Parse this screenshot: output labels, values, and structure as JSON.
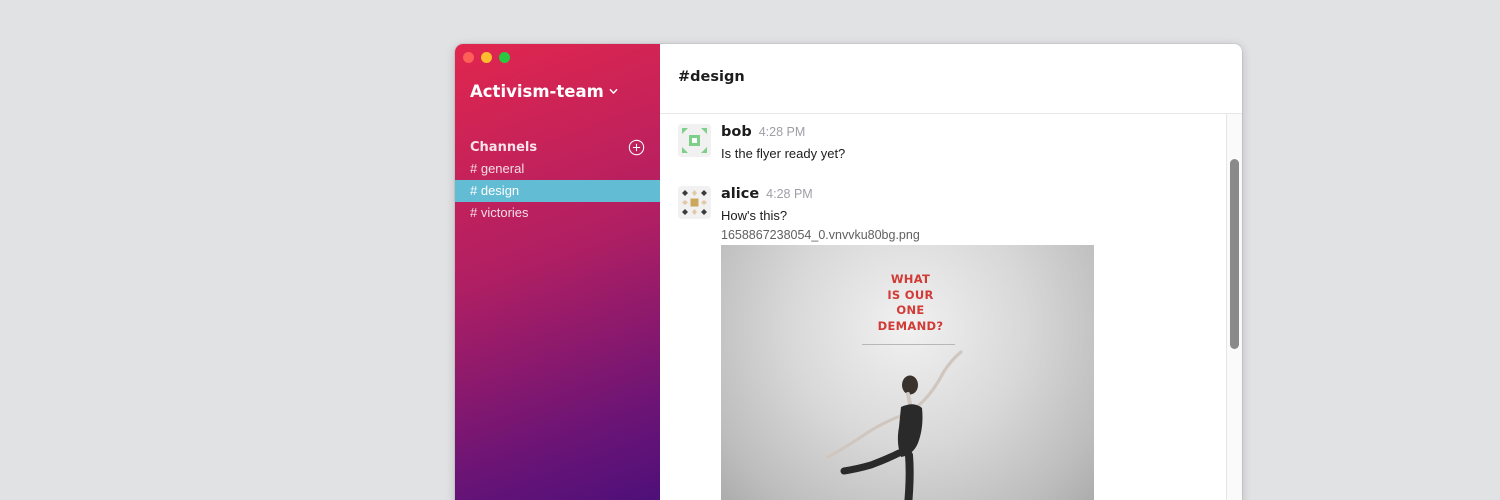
{
  "workspace": {
    "name": "Activism-team"
  },
  "sidebar": {
    "channels_label": "Channels",
    "channels": [
      {
        "label": "# general"
      },
      {
        "label": "# design"
      },
      {
        "label": "# victories"
      }
    ],
    "active_channel_color": "#62bcd4"
  },
  "channel": {
    "title": "#design"
  },
  "messages": [
    {
      "author": "bob",
      "time": "4:28 PM",
      "text": "Is the flyer ready yet?"
    },
    {
      "author": "alice",
      "time": "4:28 PM",
      "text": "How's this?",
      "attachment": {
        "file_name": "1658867238054_0.vnvvku80bg.png",
        "headline": [
          "WHAT",
          "IS OUR",
          "ONE",
          "DEMAND?"
        ]
      }
    }
  ],
  "icons": {
    "team_menu": "chevron-down-icon",
    "add_channel": "plus-circle-icon"
  },
  "colors": {
    "sidebar_gradient_start": "#e1264e",
    "sidebar_gradient_end": "#4a0f7a",
    "headline_red": "#d13a35"
  }
}
